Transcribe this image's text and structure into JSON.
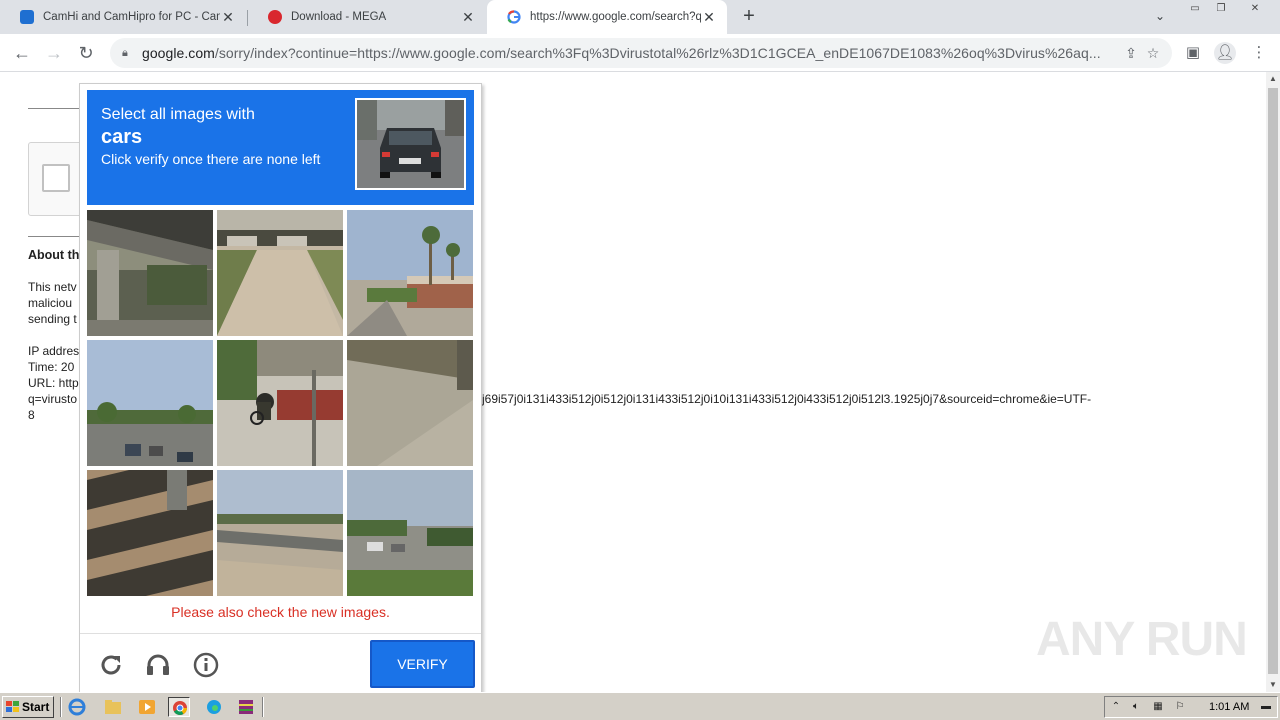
{
  "browser": {
    "tabs": [
      {
        "title": "CamHi and CamHipro for PC - Camhi",
        "close": "✕"
      },
      {
        "title": "Download - MEGA",
        "close": "✕"
      },
      {
        "title": "https://www.google.com/search?q=",
        "close": "✕"
      }
    ],
    "new_tab": "+",
    "tab_menu": "⌄",
    "address": {
      "host": "google.com",
      "path": "/sorry/index?continue=https://www.google.com/search%3Fq%3Dvirustotal%26rlz%3D1C1GCEA_enDE1067DE1083%26oq%3Dvirus%26aq..."
    }
  },
  "page": {
    "about_heading": "About th",
    "para1": [
      "This netv",
      "maliciou",
      "sending t"
    ],
    "info_lines": [
      "IP addres",
      "Time: 20",
      "URL: http",
      "q=virusto",
      "8"
    ],
    "url_tail": "j69i57j0i131i433i512j0i512j0i131i433i512j0i10i131i433i512j0i433i512j0i512l3.1925j0j7&sourceid=chrome&ie=UTF-"
  },
  "captcha": {
    "prompt_line1": "Select all images with",
    "target_word": "cars",
    "prompt_line3": "Click verify once there are none left",
    "error_text": "Please also check the new images.",
    "verify_label": "VERIFY",
    "tiles": [
      {
        "name": "tile-overpass"
      },
      {
        "name": "tile-path-bridge"
      },
      {
        "name": "tile-palm-street"
      },
      {
        "name": "tile-highway-cars"
      },
      {
        "name": "tile-cyclist"
      },
      {
        "name": "tile-pavement"
      },
      {
        "name": "tile-shadow-pillar"
      },
      {
        "name": "tile-freeway-bridge"
      },
      {
        "name": "tile-parking-lot"
      }
    ]
  },
  "watermark": "ANY RUN",
  "taskbar": {
    "start_label": "Start",
    "clock": "1:01 AM"
  }
}
